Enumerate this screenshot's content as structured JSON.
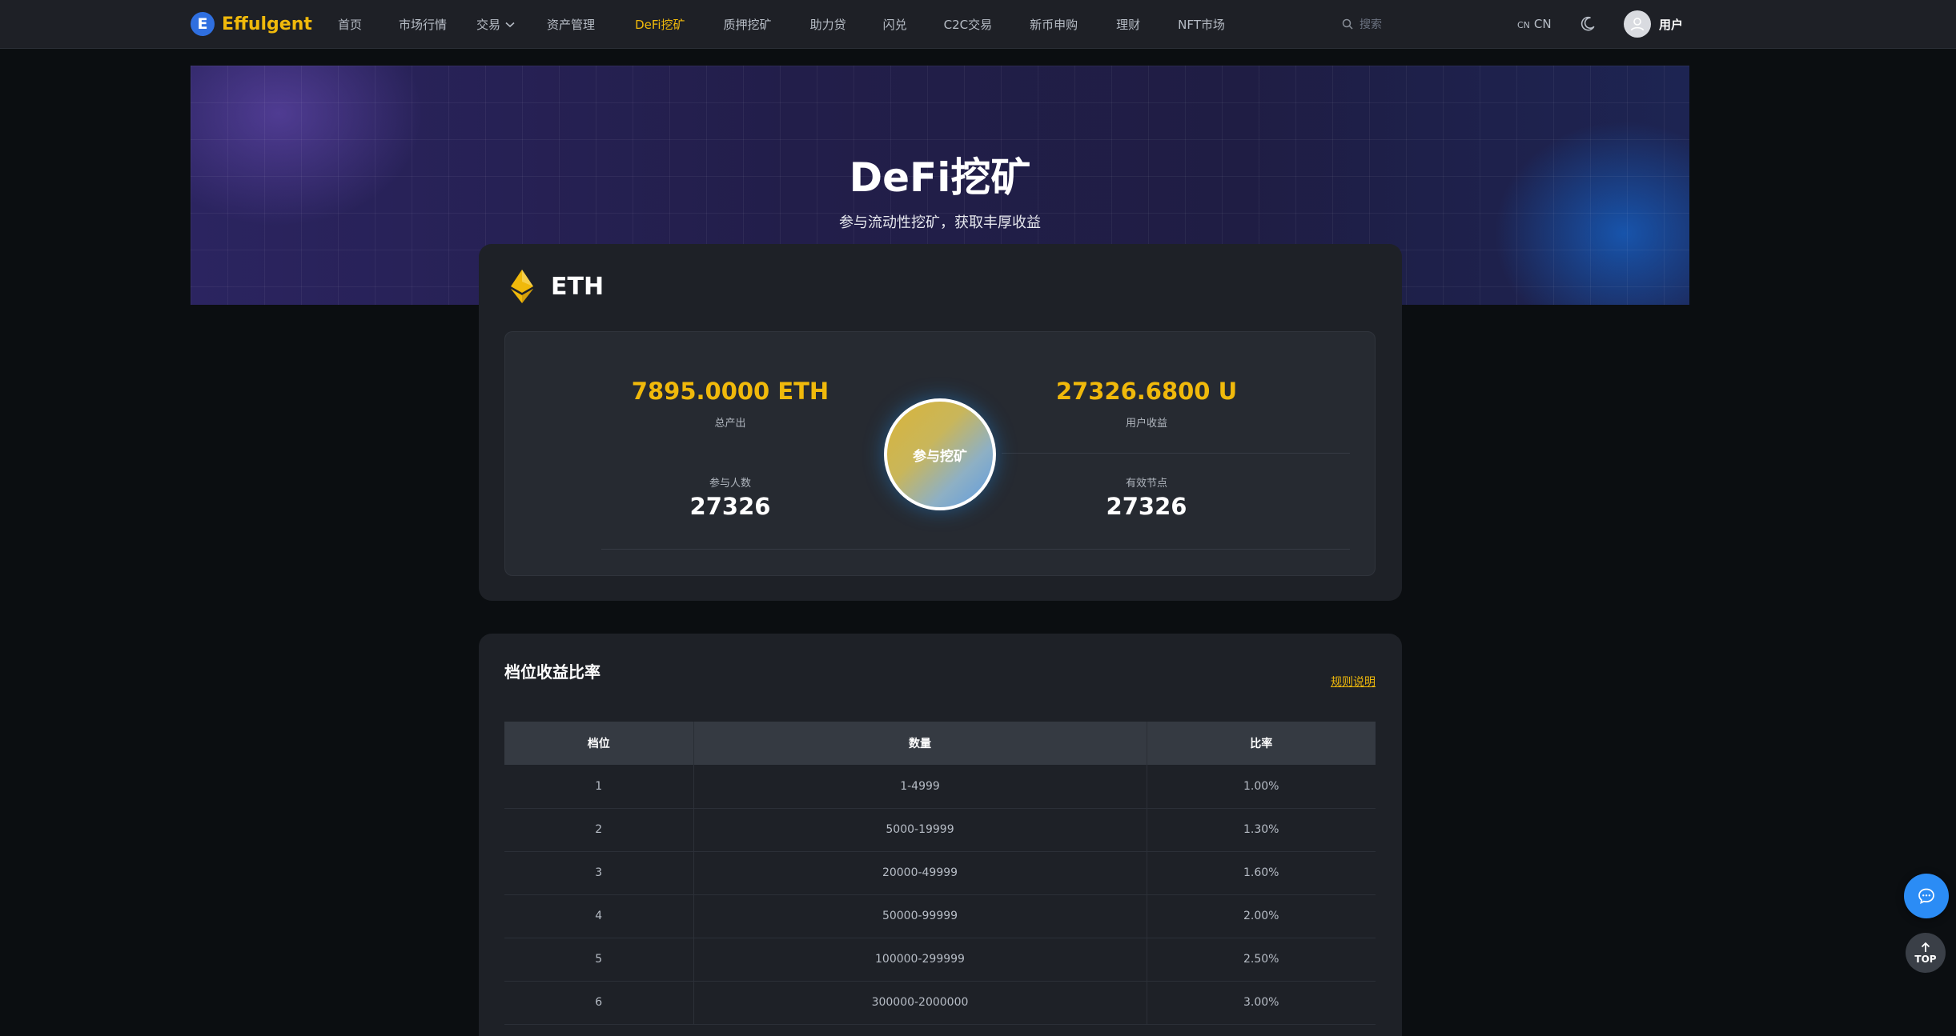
{
  "brand": {
    "logo_letter": "E",
    "name": "Effulgent"
  },
  "nav": {
    "items": [
      {
        "label": "首页"
      },
      {
        "label": "市场行情"
      },
      {
        "label": "交易",
        "dropdown": true
      },
      {
        "label": "资产管理"
      },
      {
        "label": "DeFi挖矿",
        "active": true
      },
      {
        "label": "质押挖矿"
      },
      {
        "label": "助力贷"
      },
      {
        "label": "闪兑"
      },
      {
        "label": "C2C交易"
      },
      {
        "label": "新币申购"
      },
      {
        "label": "理财"
      },
      {
        "label": "NFT市场"
      }
    ]
  },
  "search": {
    "placeholder": "搜索"
  },
  "language": {
    "small": "CN",
    "label": "CN"
  },
  "user": {
    "name": "用户"
  },
  "hero": {
    "title": "DeFi挖矿",
    "subtitle": "参与流动性挖矿，获取丰厚收益"
  },
  "eth": {
    "coin": "ETH",
    "total_output_value": "7895.0000 ETH",
    "total_output_label": "总产出",
    "user_income_value": "27326.6800 U",
    "user_income_label": "用户收益",
    "participants_label": "参与人数",
    "participants_value": "27326",
    "valid_nodes_label": "有效节点",
    "valid_nodes_value": "27326",
    "join_label": "参与挖矿"
  },
  "tier": {
    "title": "档位收益比率",
    "rules_link": "规则说明",
    "columns": [
      "档位",
      "数量",
      "比率"
    ],
    "rows": [
      [
        "1",
        "1-4999",
        "1.00%"
      ],
      [
        "2",
        "5000-19999",
        "1.30%"
      ],
      [
        "3",
        "20000-49999",
        "1.60%"
      ],
      [
        "4",
        "50000-99999",
        "2.00%"
      ],
      [
        "5",
        "100000-299999",
        "2.50%"
      ],
      [
        "6",
        "300000-2000000",
        "3.00%"
      ]
    ]
  },
  "float": {
    "top_label": "TOP"
  },
  "colors": {
    "accent": "#f0b90b",
    "chat_button": "#2b8cf5",
    "brand_logo": "#2f6fe0"
  }
}
